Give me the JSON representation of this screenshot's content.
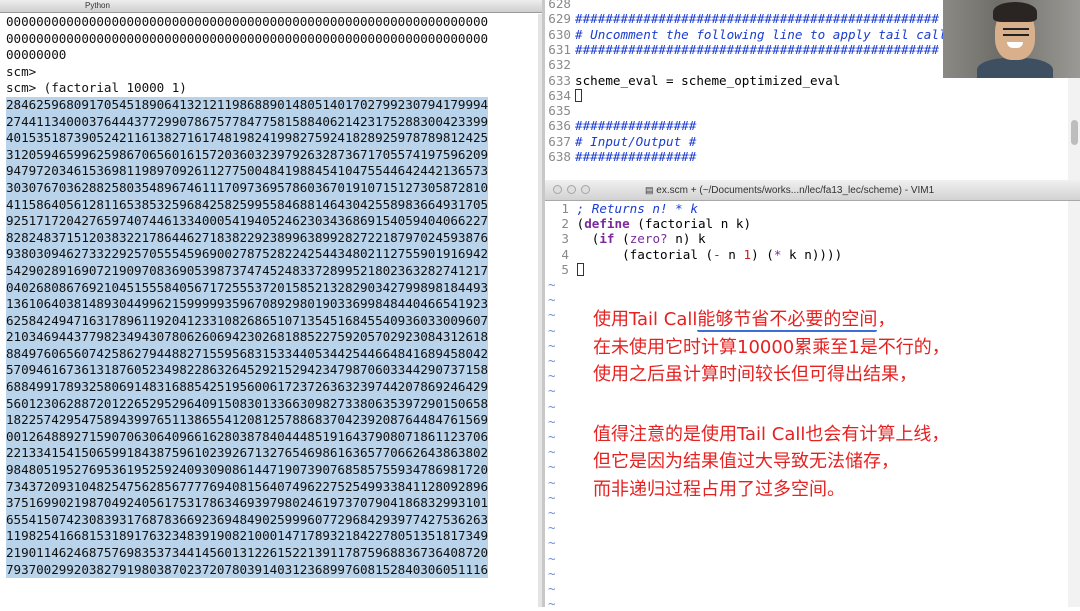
{
  "terminal": {
    "tab_title": "Python",
    "pre_lines": [
      "0000000000000000000000000000000000000000000000000000000000000000",
      "0000000000000000000000000000000000000000000000000000000000000000",
      "00000000",
      "scm>",
      "scm> (factorial 10000 1)"
    ],
    "output_lines": [
      "2846259680917054518906413212119868890148051401702799230794179994",
      "2744113400037644437729907867577847758158840621423175288300423399",
      "4015351873905242116138271617481982419982759241828925978789812425",
      "3120594659962598670656016157203603239792632873671705574197596209",
      "9479720346153698119897092611277500484198845410475544642442136573",
      "3030767036288258035489674611170973695786036701910715127305872810",
      "4115864056128116538532596842582599558468814643042558983664931705",
      "9251717204276597407446133400054194052462303436869154059404066227",
      "8282483715120383221786446271838229238996389928272218797024593876",
      "9380309462733229257055545969002787528224254434802112755901916942",
      "5429028916907219097083690539873747452483372899521802363282741217",
      "0402680867692104515558405671725553720158521328290342799898184493",
      "1361064038148930449962159999935967089298019033699848440466541923",
      "6258424947163178961192041233108268651071354516845540936033009607",
      "2103469443779823494307806260694230268188522759205702923084312618",
      "8849760656074258627944882715595683153344053442544664841689458042",
      "5709461673613187605234982286326452921529423479870603344290737158",
      "6884991789325806914831688542519560061723726363239744207869246429",
      "5601230628872012265295296409150830133663098273380635397290150658",
      "1822574295475894399765113865541208125788683704239208764484761569",
      "0012648892715907063064096616280387840444851916437908071861123706",
      "2213341541506599184387596102392671327654698616365770662643863802",
      "9848051952769536195259240930908614471907390768585755934786981720",
      "7343720931048254756285677776940815640749622752549933841128092896",
      "3751699021987049240561753178634693979802461973707904186832993101",
      "6554150742308393176878366923694849025999607729684293977427536263",
      "1198254166815318917632348391908210001471789321842278051351817349",
      "2190114624687576983537344145601312261522139117875968836736408720",
      "7937002992038279198038702372078039140312368997608152840306051116"
    ]
  },
  "vim_top": {
    "rows": [
      {
        "num": "628",
        "text": "",
        "style": "plain"
      },
      {
        "num": "629",
        "text": "################################################",
        "style": "cmtb"
      },
      {
        "num": "630",
        "text": "# Uncomment the following line to apply tail call",
        "style": "cmt"
      },
      {
        "num": "631",
        "text": "################################################",
        "style": "cmtb"
      },
      {
        "num": "632",
        "text": "",
        "style": "plain"
      },
      {
        "num": "633",
        "text": "scheme_eval = scheme_optimized_eval",
        "style": "plain"
      },
      {
        "num": "634",
        "text": "",
        "style": "cursor"
      },
      {
        "num": "635",
        "text": "",
        "style": "plain"
      },
      {
        "num": "636",
        "text": "################",
        "style": "cmtb"
      },
      {
        "num": "637",
        "text": "# Input/Output #",
        "style": "cmt"
      },
      {
        "num": "638",
        "text": "################",
        "style": "cmtb"
      }
    ]
  },
  "vim_window": {
    "title": "ex.scm + (~/Documents/works...n/lec/fa13_lec/scheme) - VIM1",
    "line1_num": "1",
    "line1_text": "; Returns n! * k",
    "line2_num": "2",
    "line3_num": "3",
    "line4_num": "4",
    "line5_num": "5",
    "tokens": {
      "lp": "(",
      "rp": ")",
      "define": "define",
      "sig": "factorial n k",
      "if": "if",
      "zero": "zero?",
      "n": "n",
      "k": "k",
      "factorial": "factorial",
      "minus": "-",
      "one": "1",
      "star": "*",
      "close4": "))))"
    },
    "tilde": "~"
  },
  "annotation": {
    "p1_line1_pre": "使用Tail Call",
    "p1_line1_underlined": "能够节省不必要的空间",
    "p1_line1_post": "，",
    "p1_line2": "在未使用它时计算10000累乘至1是不行的，",
    "p1_line3": "使用之后虽计算时间较长但可得出结果，",
    "p2_line1": "值得注意的是使用Tail Call也会有计算上线，",
    "p2_line2": "但它是因为结果值过大导致无法储存，",
    "p2_line3": "而非递归过程占用了过多空间。"
  }
}
